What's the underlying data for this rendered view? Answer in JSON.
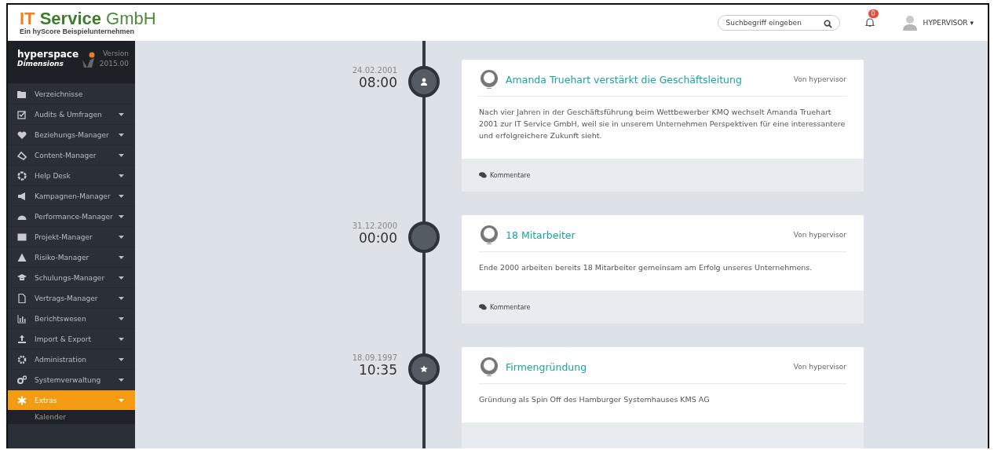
{
  "brand": {
    "title_part1": "IT",
    "title_part2": "Service",
    "title_part3": "GmbH",
    "subtitle": "Ein hyScore Beispielunternehmen"
  },
  "search": {
    "placeholder": "Suchbegriff eingeben"
  },
  "notifications": {
    "count": "0"
  },
  "user": {
    "name": "HYPERVISOR",
    "caret": "▾"
  },
  "product": {
    "name": "hyperspace",
    "edition": "Dimensions",
    "version_label": "Version",
    "version": "2015.00"
  },
  "sidebar": {
    "items": [
      {
        "label": "Verzeichnisse",
        "expandable": false,
        "selected": false
      },
      {
        "label": "Audits & Umfragen",
        "expandable": true,
        "selected": false
      },
      {
        "label": "Beziehungs-Manager",
        "expandable": true,
        "selected": false
      },
      {
        "label": "Content-Manager",
        "expandable": true,
        "selected": false
      },
      {
        "label": "Help Desk",
        "expandable": true,
        "selected": false
      },
      {
        "label": "Kampagnen-Manager",
        "expandable": true,
        "selected": false
      },
      {
        "label": "Performance-Manager",
        "expandable": true,
        "selected": false
      },
      {
        "label": "Projekt-Manager",
        "expandable": true,
        "selected": false
      },
      {
        "label": "Risiko-Manager",
        "expandable": true,
        "selected": false
      },
      {
        "label": "Schulungs-Manager",
        "expandable": true,
        "selected": false
      },
      {
        "label": "Vertrags-Manager",
        "expandable": true,
        "selected": false
      },
      {
        "label": "Berichtswesen",
        "expandable": true,
        "selected": false
      },
      {
        "label": "Import & Export",
        "expandable": true,
        "selected": false
      },
      {
        "label": "Administration",
        "expandable": true,
        "selected": false
      },
      {
        "label": "Systemverwaltung",
        "expandable": true,
        "selected": false
      },
      {
        "label": "Extras",
        "expandable": true,
        "selected": true,
        "children": [
          {
            "label": "Kalender"
          }
        ]
      }
    ]
  },
  "timeline": [
    {
      "date": "24.02.2001",
      "time": "08:00",
      "kind": "person",
      "title": "Amanda Truehart verstärkt die Geschäftsleitung",
      "author": "Von hypervisor",
      "body": "Nach vier Jahren in der Geschäftsführung beim Wettbewerber KMQ wechselt Amanda Truehart 2001 zur IT Service GmbH, weil sie in unserem Unternehmen Perspektiven für eine interessantere und erfolgreichere Zukunft sieht.",
      "comments": "Kommentare"
    },
    {
      "date": "31.12.2000",
      "time": "00:00",
      "kind": "plain",
      "title": "18 Mitarbeiter",
      "author": "Von hypervisor",
      "body": "Ende 2000 arbeiten bereits 18 Mitarbeiter gemeinsam am Erfolg unseres Unternehmens.",
      "comments": "Kommentare"
    },
    {
      "date": "18.09.1997",
      "time": "10:35",
      "kind": "star",
      "title": "Firmengründung",
      "author": "Von hypervisor",
      "body": "Gründung als Spin Off des Hamburger Systemhauses KMS AG"
    }
  ]
}
